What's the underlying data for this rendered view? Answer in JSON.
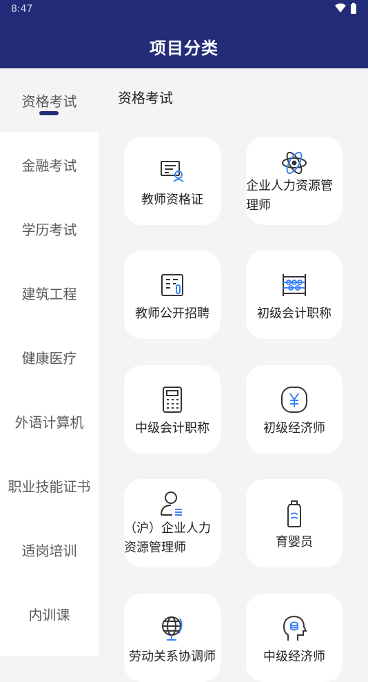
{
  "status_bar": {
    "time": "8:47"
  },
  "header": {
    "title": "项目分类"
  },
  "sidebar": {
    "items": [
      {
        "label": "资格考试"
      },
      {
        "label": "金融考试"
      },
      {
        "label": "学历考试"
      },
      {
        "label": "建筑工程"
      },
      {
        "label": "健康医疗"
      },
      {
        "label": "外语计算机"
      },
      {
        "label": "职业技能证书"
      },
      {
        "label": "适岗培训"
      },
      {
        "label": "内训课"
      }
    ]
  },
  "main": {
    "section_title": "资格考试",
    "cards": [
      {
        "label": "教师资格证",
        "icon": "certificate-screen-icon"
      },
      {
        "label": "企业人力资源管理师",
        "icon": "atom-icon"
      },
      {
        "label": "教师公开招聘",
        "icon": "document-list-icon"
      },
      {
        "label": "初级会计职称",
        "icon": "abacus-icon"
      },
      {
        "label": "中级会计职称",
        "icon": "calculator-icon"
      },
      {
        "label": "初级经济师",
        "icon": "yen-icon"
      },
      {
        "label": "（沪）企业人力资源管理师",
        "icon": "person-list-icon"
      },
      {
        "label": "育婴员",
        "icon": "baby-bottle-icon"
      },
      {
        "label": "劳动关系协调师",
        "icon": "globe-icon"
      },
      {
        "label": "中级经济师",
        "icon": "head-coin-icon"
      }
    ]
  },
  "colors": {
    "header_bg": "#232c78",
    "accent": "#232c78",
    "icon_blue": "#3b82f6"
  }
}
